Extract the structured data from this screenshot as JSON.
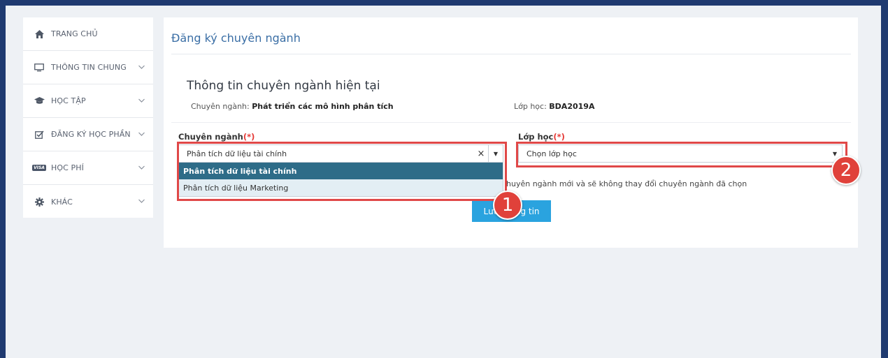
{
  "sidebar": {
    "items": [
      {
        "label": "TRANG CHỦ",
        "icon": "home-icon",
        "has_chevron": false
      },
      {
        "label": "THÔNG TIN CHUNG",
        "icon": "monitor-icon",
        "has_chevron": true
      },
      {
        "label": "HỌC TẬP",
        "icon": "graduation-cap-icon",
        "has_chevron": true
      },
      {
        "label": "ĐĂNG KÝ HỌC PHẦN",
        "icon": "checkbox-icon",
        "has_chevron": true
      },
      {
        "label": "HỌC PHÍ",
        "icon": "visa-card-icon",
        "has_chevron": true
      },
      {
        "label": "KHÁC",
        "icon": "gear-icon",
        "has_chevron": true
      }
    ],
    "visa_badge": "VISA"
  },
  "page": {
    "title": "Đăng ký chuyên ngành",
    "section_heading": "Thông tin chuyên ngành hiện tại",
    "current_major_label": "Chuyên ngành:",
    "current_major_value": "Phát triển các mô hình phân tích",
    "current_class_label": "Lớp học:",
    "current_class_value": "BDA2019A"
  },
  "form": {
    "major_label": "Chuyên ngành",
    "class_label": "Lớp học",
    "required_mark": "(*)",
    "major_selected": "Phân tích dữ liệu tài chính",
    "clear_symbol": "×",
    "class_placeholder": "Chọn lớp học",
    "major_options": [
      "Phân tích dữ liệu tài chính",
      "Phân tích dữ liệu Marketing"
    ],
    "note": "huyên ngành mới và sẽ không thay đổi chuyên ngành đã chọn",
    "save_label": "Lưu thông tin"
  },
  "annotations": {
    "marker_1": "1",
    "marker_2": "2"
  },
  "colors": {
    "frame_border": "#1f3a70",
    "accent_title": "#3a6ea5",
    "option_active": "#2e6c88",
    "button": "#2aa3df",
    "highlight": "#e04848"
  }
}
